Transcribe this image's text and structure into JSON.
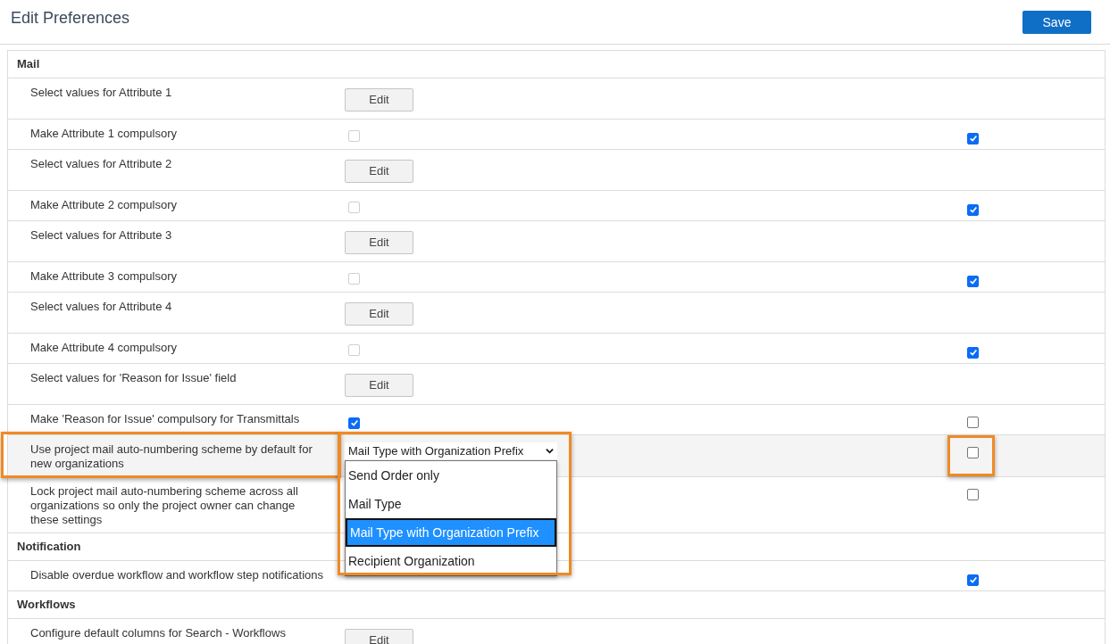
{
  "header": {
    "title": "Edit Preferences",
    "save_button": "Save"
  },
  "rows": [
    {
      "kind": "section",
      "label": "Mail"
    },
    {
      "kind": "edit",
      "label": "Select values for Attribute 1",
      "button": "Edit"
    },
    {
      "kind": "checkbox",
      "label": "Make Attribute 1 compulsory",
      "middle": {
        "checked": false,
        "disabled": true
      },
      "right": {
        "checked": true
      }
    },
    {
      "kind": "edit",
      "label": "Select values for Attribute 2",
      "button": "Edit"
    },
    {
      "kind": "checkbox",
      "label": "Make Attribute 2 compulsory",
      "middle": {
        "checked": false,
        "disabled": true
      },
      "right": {
        "checked": true
      }
    },
    {
      "kind": "edit",
      "label": "Select values for Attribute 3",
      "button": "Edit"
    },
    {
      "kind": "checkbox",
      "label": "Make Attribute 3 compulsory",
      "middle": {
        "checked": false,
        "disabled": true
      },
      "right": {
        "checked": true
      }
    },
    {
      "kind": "edit",
      "label": "Select values for Attribute 4",
      "button": "Edit"
    },
    {
      "kind": "checkbox",
      "label": "Make Attribute 4 compulsory",
      "middle": {
        "checked": false,
        "disabled": true
      },
      "right": {
        "checked": true
      }
    },
    {
      "kind": "edit",
      "label": "Select values for 'Reason for Issue' field",
      "button": "Edit"
    },
    {
      "kind": "checkbox",
      "label": "Make 'Reason for Issue' compulsory for Transmittals",
      "middle": {
        "checked": true,
        "disabled": false
      },
      "right": {
        "checked": false
      }
    },
    {
      "kind": "select",
      "label": "Use project mail auto-numbering scheme by default for new organizations",
      "highlighted": true,
      "label_callout": true,
      "select_callout": true,
      "right_callout": true,
      "value": "Mail Type with Organization Prefix",
      "expanded": true,
      "options": [
        {
          "label": "Send Order only",
          "selected": false
        },
        {
          "label": "Mail Type",
          "selected": false
        },
        {
          "label": "Mail Type with Organization Prefix",
          "selected": true
        },
        {
          "label": "Recipient Organization",
          "selected": false
        }
      ],
      "right": {
        "checked": false
      }
    },
    {
      "kind": "checkbox",
      "label": "Lock project mail auto-numbering scheme across all organizations so only the project owner can change these settings",
      "right": {
        "checked": false
      }
    },
    {
      "kind": "section",
      "label": "Notification"
    },
    {
      "kind": "checkbox",
      "label": "Disable overdue workflow and workflow step notifications",
      "right": {
        "checked": true
      }
    },
    {
      "kind": "section",
      "label": "Workflows"
    },
    {
      "kind": "edit",
      "label": "Configure default columns for Search - Workflows",
      "button": "Edit"
    }
  ]
}
